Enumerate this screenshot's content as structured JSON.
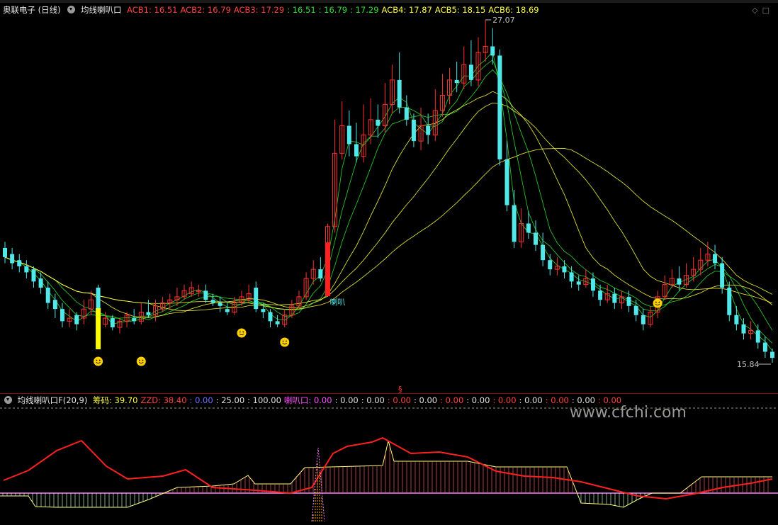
{
  "header": {
    "stock_name": "奥联电子 (日线)",
    "indicator_name": "均线喇叭口",
    "acb": [
      {
        "label": "ACB1: 16.51",
        "color": "#ff4040"
      },
      {
        "label": "ACB2: 16.79",
        "color": "#ff4040"
      },
      {
        "label": "ACB3: 17.29",
        "color": "#ff4040"
      },
      {
        "label": ": 16.51",
        "color": "#30e030"
      },
      {
        "label": ": 16.79",
        "color": "#30e030"
      },
      {
        "label": ": 17.29",
        "color": "#30e030"
      },
      {
        "label": "ACB4: 17.87",
        "color": "#ffff40"
      },
      {
        "label": "ACB5: 18.15",
        "color": "#ffff40"
      },
      {
        "label": "ACB6: 18.69",
        "color": "#ffff40"
      }
    ]
  },
  "sub_header": {
    "indicator_name": "均线喇叭口F(20,9)",
    "values": [
      {
        "label": "筹码: 39.70",
        "color": "#ffff40"
      },
      {
        "label": "ZZD: 38.40",
        "color": "#ff4040"
      },
      {
        "label": ": 0.00",
        "color": "#7070ff"
      },
      {
        "label": ": 25.00",
        "color": "#e0e0e0"
      },
      {
        "label": ": 100.00",
        "color": "#e0e0e0"
      },
      {
        "label": "喇叭口: 0.00",
        "color": "#ff50ff"
      },
      {
        "label": ": 0.00",
        "color": "#e0e0e0"
      },
      {
        "label": ": 0.00",
        "color": "#e0e0e0"
      },
      {
        "label": ": 0.00",
        "color": "#ff4040"
      },
      {
        "label": ": 0.00",
        "color": "#e0e0e0"
      },
      {
        "label": ": 0.00",
        "color": "#ff4040"
      },
      {
        "label": ": 0.00",
        "color": "#e0e0e0"
      },
      {
        "label": ": 0.00",
        "color": "#ff4040"
      },
      {
        "label": ": 0.00",
        "color": "#e0e0e0"
      },
      {
        "label": ": 0.00",
        "color": "#ff4040"
      },
      {
        "label": ": 0.00",
        "color": "#e0e0e0"
      },
      {
        "label": ": 0.00",
        "color": "#ff4040"
      }
    ]
  },
  "annotations": {
    "high_label": "27.07",
    "low_label": "15.84",
    "signal_text": "喇叭",
    "marker": "§"
  },
  "watermark": "www.cfchi.com",
  "colors": {
    "up": "#ff3030",
    "down": "#50e8e8",
    "ma_green": "#30e030",
    "ma_yellow": "#ffff40",
    "zzd": "#ff2020",
    "chip": "#ffff80"
  },
  "chart_data": [
    {
      "type": "candlestick",
      "price_high": 27.07,
      "price_low": 15.84,
      "moving_averages": [
        {
          "name": "ACB1",
          "last": 16.51
        },
        {
          "name": "ACB2",
          "last": 16.79
        },
        {
          "name": "ACB3",
          "last": 17.29
        },
        {
          "name": "ACB4",
          "last": 17.87
        },
        {
          "name": "ACB5",
          "last": 18.15
        },
        {
          "name": "ACB6",
          "last": 18.69
        }
      ]
    },
    {
      "type": "line",
      "indicator": "均线喇叭口F(20,9)",
      "series": [
        {
          "name": "筹码",
          "last": 39.7
        },
        {
          "name": "ZZD",
          "last": 38.4
        }
      ],
      "levels": [
        0,
        25,
        100
      ]
    }
  ]
}
